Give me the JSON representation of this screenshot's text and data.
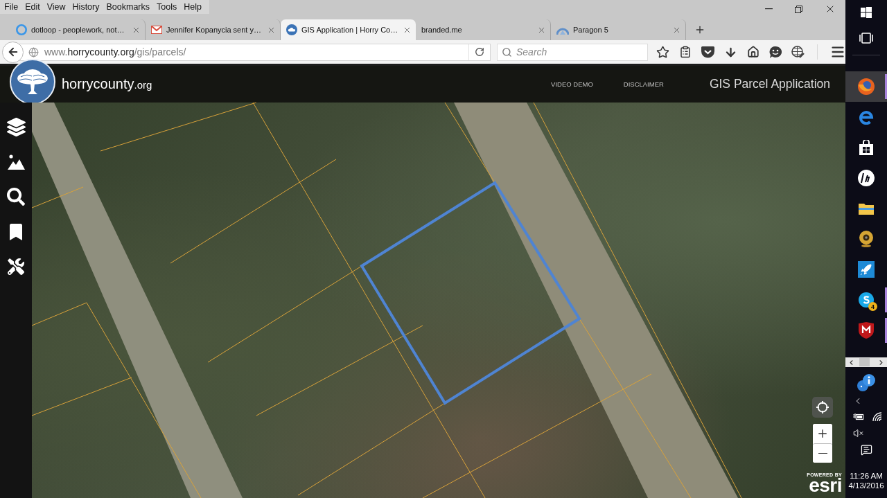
{
  "menu_bar": [
    "File",
    "Edit",
    "View",
    "History",
    "Bookmarks",
    "Tools",
    "Help"
  ],
  "tabs": [
    {
      "title": "dotloop - peoplework, not…",
      "kind": "ring",
      "selected": false
    },
    {
      "title": "Jennifer Kopanycia sent y…",
      "kind": "mail",
      "selected": false
    },
    {
      "title": "GIS Application | Horry Co…",
      "kind": "cloud",
      "selected": true
    },
    {
      "title": "branded.me",
      "kind": "plain",
      "selected": false
    },
    {
      "title": "Paragon 5",
      "kind": "arc",
      "selected": false
    }
  ],
  "address_bar": {
    "url": {
      "prefix": "www.",
      "host": "horrycounty.org",
      "path": "/gis/parcels/"
    }
  },
  "search": {
    "placeholder": "Search"
  },
  "app_header": {
    "site_name": [
      {
        "text": "horrycounty",
        "kind": "name"
      },
      {
        "text": ".org",
        "kind": "domain"
      }
    ],
    "links": [
      "VIDEO DEMO",
      "DISCLAIMER"
    ],
    "title": "GIS Parcel Application"
  },
  "map": {
    "attribution": {
      "caption": "POWERED BY",
      "logo": "esri"
    }
  },
  "taskbar": {
    "apps": [
      {
        "kind": "firefox",
        "active": true,
        "running": true
      },
      {
        "kind": "edge",
        "active": false,
        "running": false
      },
      {
        "kind": "store",
        "active": false,
        "running": false
      },
      {
        "kind": "hp",
        "active": false,
        "running": false
      },
      {
        "kind": "explorer",
        "active": false,
        "running": false
      },
      {
        "kind": "webcam",
        "active": false,
        "running": false
      },
      {
        "kind": "rocket",
        "active": false,
        "running": false
      },
      {
        "kind": "skype",
        "active": false,
        "running": true,
        "badge": "4"
      },
      {
        "kind": "mcafee",
        "active": false,
        "running": true
      }
    ],
    "clock": {
      "time": "11:26 AM",
      "date": "4/13/2016"
    }
  }
}
